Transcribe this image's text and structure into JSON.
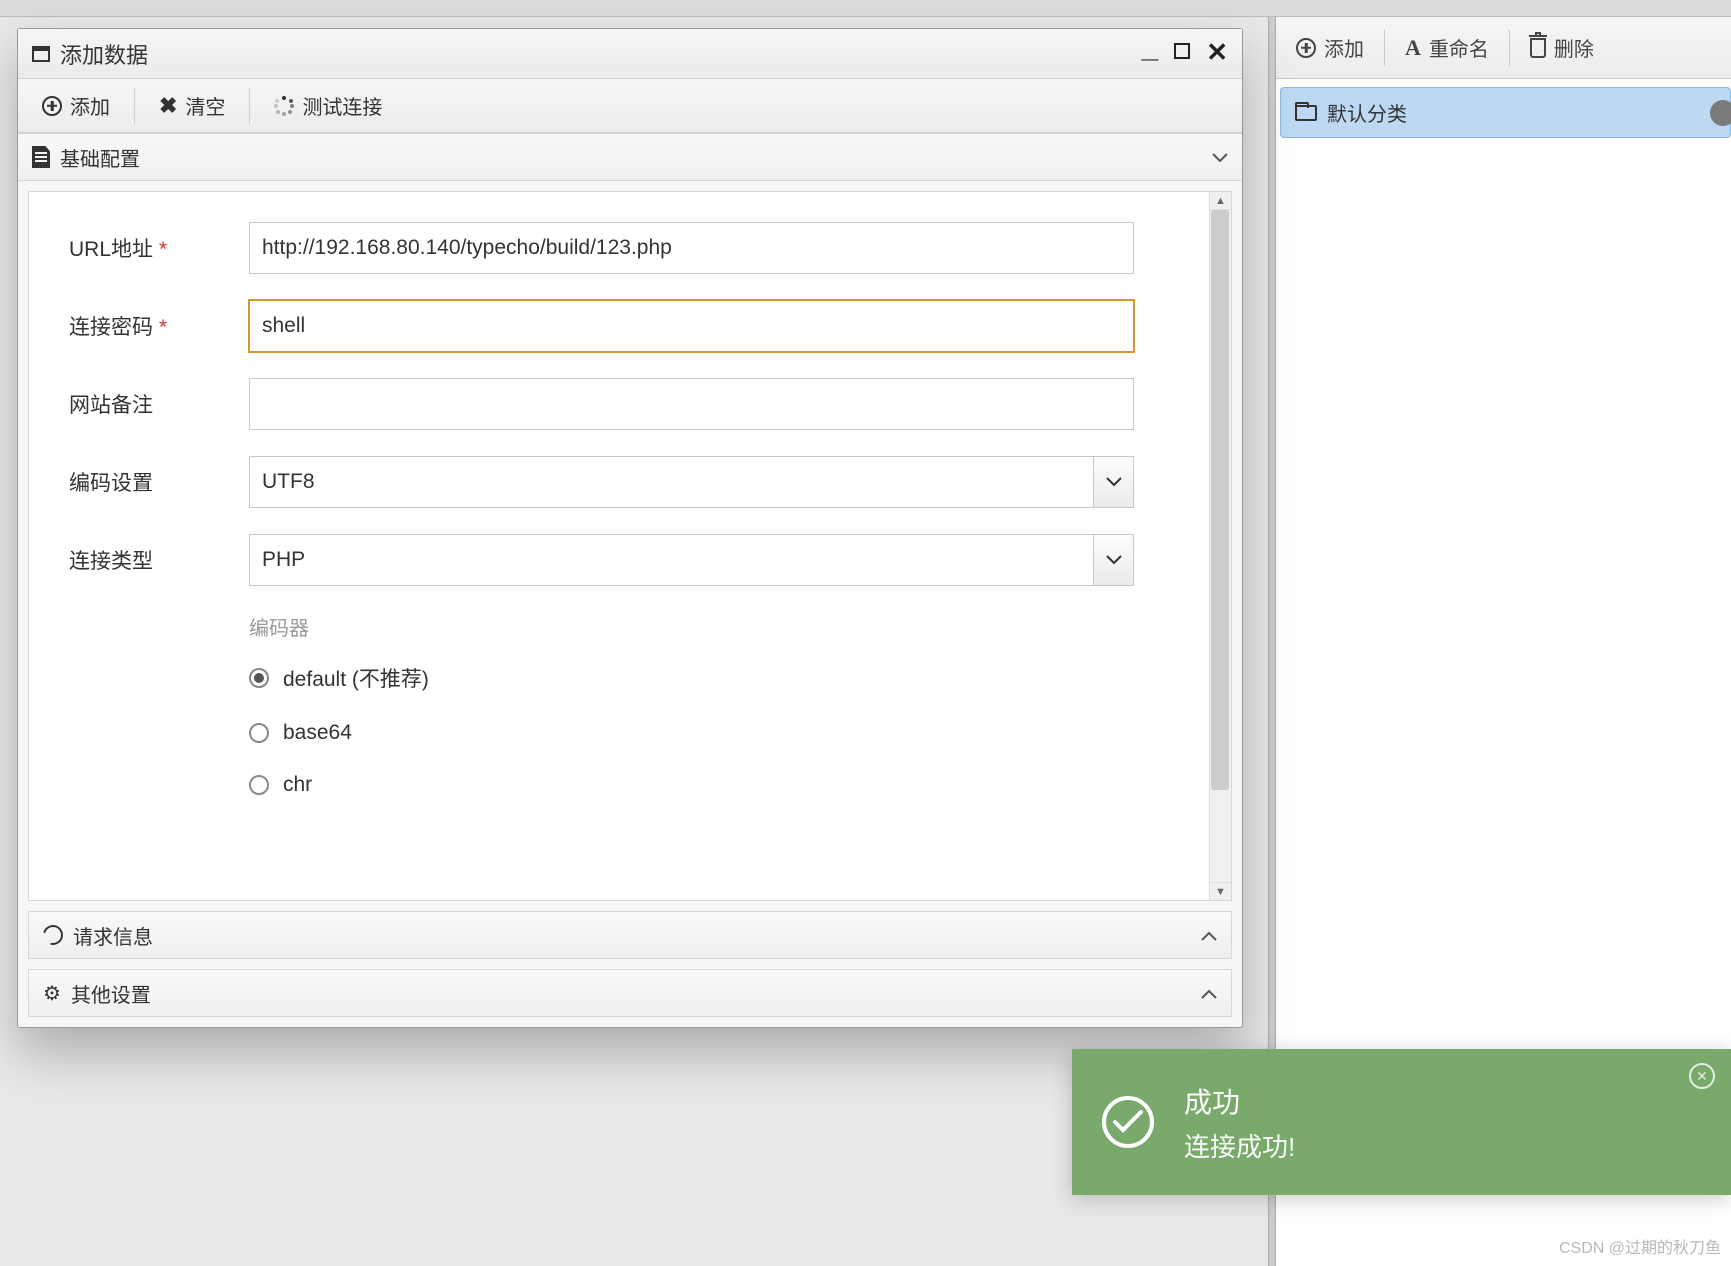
{
  "dialog": {
    "title": "添加数据",
    "toolbar": {
      "add": "添加",
      "clear": "清空",
      "test_connection": "测试连接"
    },
    "sections": {
      "basic": "基础配置",
      "request": "请求信息",
      "other": "其他设置"
    },
    "form": {
      "url": {
        "label": "URL地址",
        "value": "http://192.168.80.140/typecho/build/123.php"
      },
      "password": {
        "label": "连接密码",
        "value": "shell"
      },
      "note": {
        "label": "网站备注",
        "value": ""
      },
      "encoding": {
        "label": "编码设置",
        "value": "UTF8"
      },
      "conn_type": {
        "label": "连接类型",
        "value": "PHP"
      },
      "encoder_label": "编码器",
      "encoder_options": [
        {
          "label": "default (不推荐)",
          "checked": true
        },
        {
          "label": "base64",
          "checked": false
        },
        {
          "label": "chr",
          "checked": false
        }
      ]
    }
  },
  "right_panel": {
    "toolbar": {
      "add": "添加",
      "rename": "重命名",
      "delete": "删除"
    },
    "items": [
      {
        "label": "默认分类"
      }
    ]
  },
  "toast": {
    "title": "成功",
    "message": "连接成功!"
  },
  "watermark": "CSDN @过期的秋刀鱼"
}
